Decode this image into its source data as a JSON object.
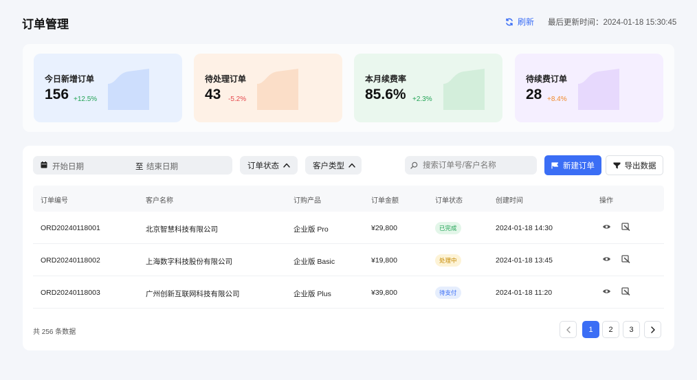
{
  "header": {
    "title": "订单管理",
    "refresh_label": "刷新",
    "updated_text": "最后更新时间：2024-01-18 15:30:45"
  },
  "stats": [
    {
      "label": "今日新增订单",
      "value": "156",
      "change": "+12.5%",
      "change_color": "#22a355",
      "bg": "#e9f1fe",
      "deco": "#c6d9fc"
    },
    {
      "label": "待处理订单",
      "value": "43",
      "change": "-5.2%",
      "change_color": "#e5484d",
      "bg": "#fef1e6",
      "deco": "#fad9c0"
    },
    {
      "label": "本月续费率",
      "value": "85.6%",
      "change": "+2.3%",
      "change_color": "#22a355",
      "bg": "#eaf7ee",
      "deco": "#cdebd6"
    },
    {
      "label": "待续费订单",
      "value": "28",
      "change": "+8.4%",
      "change_color": "#f0892a",
      "bg": "#f5efff",
      "deco": "#e4d3fd"
    }
  ],
  "filters": {
    "start_date": "开始日期",
    "range_sep": "至",
    "end_date": "结束日期",
    "status_label": "订单状态",
    "type_label": "客户类型",
    "search_placeholder": "搜索订单号/客户名称",
    "create_label": "新建订单",
    "export_label": "导出数据"
  },
  "table": {
    "columns": [
      "订单编号",
      "客户名称",
      "订购产品",
      "订单金额",
      "订单状态",
      "创建时间",
      "操作"
    ],
    "rows": [
      {
        "id": "ORD20240118001",
        "customer": "北京智慧科技有限公司",
        "product": "企业版 Pro",
        "amount": "¥29,800",
        "status": "已完成",
        "created": "2024-01-18 14:30"
      },
      {
        "id": "ORD20240118002",
        "customer": "上海数字科技股份有限公司",
        "product": "企业版 Basic",
        "amount": "¥19,800",
        "status": "处理中",
        "created": "2024-01-18 13:45"
      },
      {
        "id": "ORD20240118003",
        "customer": "广州创新互联网科技有限公司",
        "product": "企业版 Plus",
        "amount": "¥39,800",
        "status": "待支付",
        "created": "2024-01-18 11:20"
      }
    ]
  },
  "status_colors": {
    "已完成": {
      "bg": "#e3f6e9",
      "fg": "#22a355"
    },
    "处理中": {
      "bg": "#fdf3d6",
      "fg": "#c58a05"
    },
    "待支付": {
      "bg": "#e6eefd",
      "fg": "#3b6ef5"
    }
  },
  "footer": {
    "total": "共 256 条数据",
    "pages": [
      "1",
      "2",
      "3"
    ],
    "current_page": "1"
  },
  "icons": {
    "refresh": "refresh-icon",
    "calendar": "calendar-icon",
    "chevron": "chevron-up-icon",
    "search": "search-icon",
    "create": "flag-icon",
    "export": "filter-icon",
    "view": "eye-icon",
    "edit": "edit-icon"
  }
}
